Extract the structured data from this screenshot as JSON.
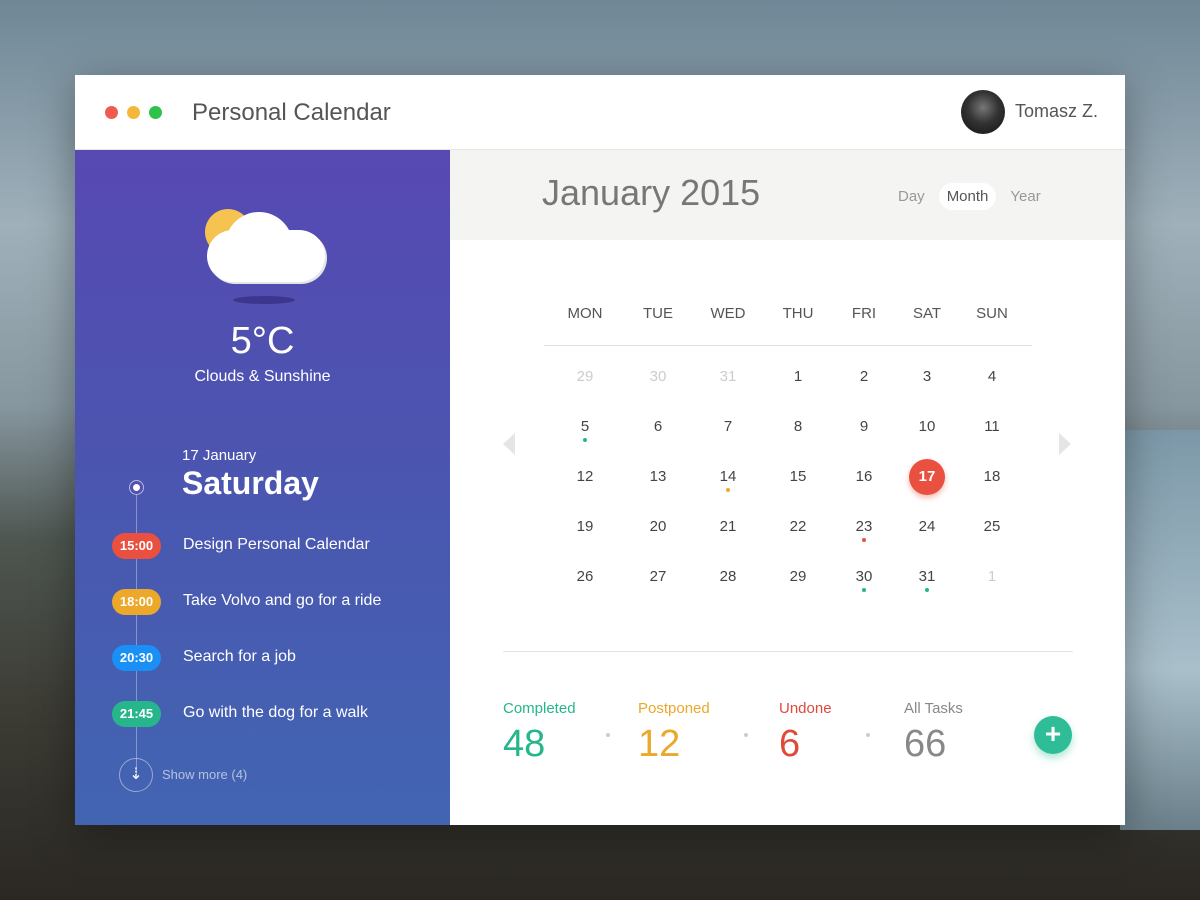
{
  "app": {
    "title": "Personal Calendar",
    "user": "Tomasz Z.",
    "window_controls": [
      "#f05b4f",
      "#f4b73a",
      "#2fc24a"
    ]
  },
  "weather": {
    "temperature": "5°C",
    "condition": "Clouds & Sunshine",
    "icon": "sun-cloud-icon"
  },
  "agenda": {
    "date": "17 January",
    "weekday": "Saturday",
    "events": [
      {
        "time": "15:00",
        "title": "Design Personal Calendar",
        "color": "#e9503f"
      },
      {
        "time": "18:00",
        "title": "Take Volvo and go for a ride",
        "color": "#eba82a"
      },
      {
        "time": "20:30",
        "title": "Search for a job",
        "color": "#1a8ff5"
      },
      {
        "time": "21:45",
        "title": "Go with the dog for a walk",
        "color": "#27b68b"
      }
    ],
    "show_more": "Show more (4)"
  },
  "calendar": {
    "month_label": "January 2015",
    "views": [
      "Day",
      "Month",
      "Year"
    ],
    "active_view": "Month",
    "weekdays": [
      "MON",
      "TUE",
      "WED",
      "THU",
      "FRI",
      "SAT",
      "SUN"
    ],
    "weeks": [
      [
        {
          "d": "29",
          "m": 1
        },
        {
          "d": "30",
          "m": 1
        },
        {
          "d": "31",
          "m": 1
        },
        {
          "d": "1"
        },
        {
          "d": "2"
        },
        {
          "d": "3"
        },
        {
          "d": "4"
        }
      ],
      [
        {
          "d": "5",
          "dot": "#27b68b"
        },
        {
          "d": "6"
        },
        {
          "d": "7"
        },
        {
          "d": "8"
        },
        {
          "d": "9"
        },
        {
          "d": "10"
        },
        {
          "d": "11"
        }
      ],
      [
        {
          "d": "12"
        },
        {
          "d": "13"
        },
        {
          "d": "14",
          "dot": "#eba82a"
        },
        {
          "d": "15"
        },
        {
          "d": "16"
        },
        {
          "d": "17",
          "sel": 1
        },
        {
          "d": "18"
        }
      ],
      [
        {
          "d": "19"
        },
        {
          "d": "20"
        },
        {
          "d": "21"
        },
        {
          "d": "22"
        },
        {
          "d": "23",
          "dot": "#e9503f"
        },
        {
          "d": "24"
        },
        {
          "d": "25"
        }
      ],
      [
        {
          "d": "26"
        },
        {
          "d": "27"
        },
        {
          "d": "28"
        },
        {
          "d": "29"
        },
        {
          "d": "30",
          "dot": "#27b68b"
        },
        {
          "d": "31",
          "dot": "#27b68b"
        },
        {
          "d": "1",
          "m": 1
        }
      ]
    ]
  },
  "stats": [
    {
      "label": "Completed",
      "value": "48",
      "color": "#27b68b"
    },
    {
      "label": "Postponed",
      "value": "12",
      "color": "#eba82a"
    },
    {
      "label": "Undone",
      "value": "6",
      "color": "#e04a3a"
    },
    {
      "label": "All Tasks",
      "value": "66",
      "color": "#888888"
    }
  ],
  "add_button": "+"
}
